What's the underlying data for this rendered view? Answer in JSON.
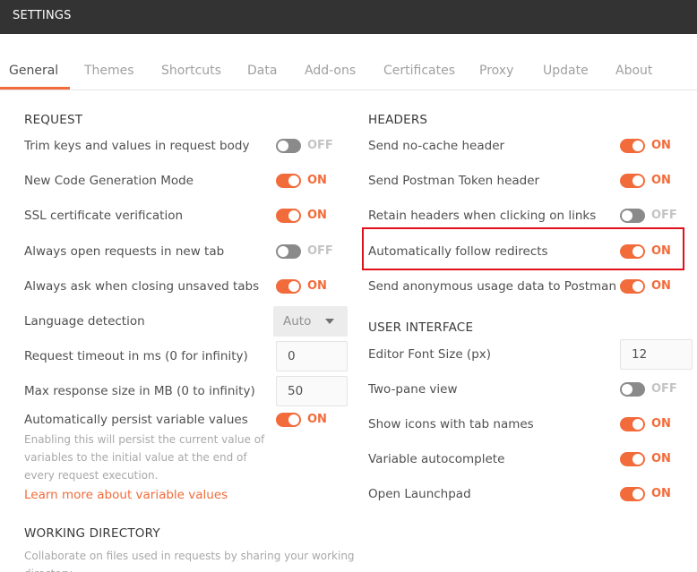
{
  "window": {
    "title": "SETTINGS"
  },
  "tabs": [
    {
      "label": "General",
      "active": true
    },
    {
      "label": "Themes"
    },
    {
      "label": "Shortcuts"
    },
    {
      "label": "Data"
    },
    {
      "label": "Add-ons"
    },
    {
      "label": "Certificates"
    },
    {
      "label": "Proxy"
    },
    {
      "label": "Update"
    },
    {
      "label": "About"
    }
  ],
  "request": {
    "heading": "REQUEST",
    "trim_keys": {
      "label": "Trim keys and values in request body",
      "state": "OFF"
    },
    "new_codegen": {
      "label": "New Code Generation Mode",
      "state": "ON"
    },
    "ssl_verification": {
      "label": "SSL certificate verification",
      "state": "ON"
    },
    "open_new_tab": {
      "label": "Always open requests in new tab",
      "state": "OFF"
    },
    "ask_closing": {
      "label": "Always ask when closing unsaved tabs",
      "state": "ON"
    },
    "language_detection": {
      "label": "Language detection",
      "value": "Auto"
    },
    "timeout": {
      "label": "Request timeout in ms (0 for infinity)",
      "value": "0"
    },
    "max_response": {
      "label": "Max response size in MB (0 to infinity)",
      "value": "50"
    },
    "persist_vars": {
      "label": "Automatically persist variable values",
      "state": "ON",
      "hint": "Enabling this will persist the current value of variables to the initial value at the end of every request execution.",
      "link": "Learn more about variable values"
    }
  },
  "working_directory": {
    "heading": "WORKING DIRECTORY",
    "hint": "Collaborate on files used in requests by sharing your working directory"
  },
  "headers": {
    "heading": "HEADERS",
    "no_cache": {
      "label": "Send no-cache header",
      "state": "ON"
    },
    "postman_token": {
      "label": "Send Postman Token header",
      "state": "ON"
    },
    "retain_headers": {
      "label": "Retain headers when clicking on links",
      "state": "OFF"
    },
    "follow_redirects": {
      "label": "Automatically follow redirects",
      "state": "ON"
    },
    "anonymous_usage": {
      "label": "Send anonymous usage data to Postman",
      "state": "ON"
    }
  },
  "user_interface": {
    "heading": "USER INTERFACE",
    "font_size": {
      "label": "Editor Font Size (px)",
      "value": "12"
    },
    "two_pane": {
      "label": "Two-pane view",
      "state": "OFF"
    },
    "icons_tab_names": {
      "label": "Show icons with tab names",
      "state": "ON"
    },
    "variable_autocomplete": {
      "label": "Variable autocomplete",
      "state": "ON"
    },
    "open_launchpad": {
      "label": "Open Launchpad",
      "state": "ON"
    }
  },
  "colors": {
    "accent": "#f26b3a",
    "titlebar": "#333333",
    "toggle_off": "#8a8a8a",
    "highlight_box": "#e2101b"
  }
}
